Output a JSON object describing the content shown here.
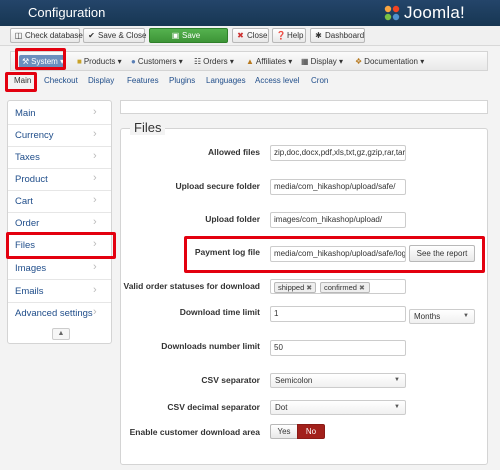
{
  "window": {
    "title": "Configuration",
    "brand": "Joomla!"
  },
  "toolbar": {
    "check_database": "Check database",
    "save_close": "Save & Close",
    "save": "Save",
    "close": "Close",
    "help": "Help",
    "dashboard": "Dashboard"
  },
  "menu": {
    "system": "System",
    "products": "Products",
    "customers": "Customers",
    "orders": "Orders",
    "affiliates": "Affiliates",
    "display": "Display",
    "documentation": "Documentation"
  },
  "subtabs": [
    "Main",
    "Checkout",
    "Display",
    "Features",
    "Plugins",
    "Languages",
    "Access level",
    "Cron"
  ],
  "leftnav": [
    "Main",
    "Currency",
    "Taxes",
    "Product",
    "Cart",
    "Order",
    "Files",
    "Images",
    "Emails",
    "Advanced settings"
  ],
  "section_title": "Files",
  "fields": {
    "allowed_files": {
      "label": "Allowed files",
      "value": "zip,doc,docx,pdf,xls,txt,gz,gzip,rar,tar,tgz"
    },
    "upload_secure_folder": {
      "label": "Upload secure folder",
      "value": "media/com_hikashop/upload/safe/"
    },
    "upload_folder": {
      "label": "Upload folder",
      "value": "images/com_hikashop/upload/"
    },
    "payment_log_file": {
      "label": "Payment log file",
      "value": "media/com_hikashop/upload/safe/logs/",
      "button": "See the report"
    },
    "valid_order_statuses": {
      "label": "Valid order statuses for download",
      "tags": [
        "shipped",
        "confirmed"
      ]
    },
    "download_time_limit": {
      "label": "Download time limit",
      "value": "1",
      "unit": "Months"
    },
    "downloads_number_limit": {
      "label": "Downloads number limit",
      "value": "50"
    },
    "csv_separator": {
      "label": "CSV separator",
      "value": "Semicolon"
    },
    "csv_decimal_separator": {
      "label": "CSV decimal separator",
      "value": "Dot"
    },
    "customer_download_area": {
      "label": "Enable customer download area",
      "yes": "Yes",
      "no": "No",
      "selected": "No"
    }
  },
  "colors": {
    "highlight": "#e3000f",
    "link": "#1f4d8a",
    "save_green": "#3d9537",
    "toggle_active": "#a2201b",
    "header": "#173652"
  }
}
